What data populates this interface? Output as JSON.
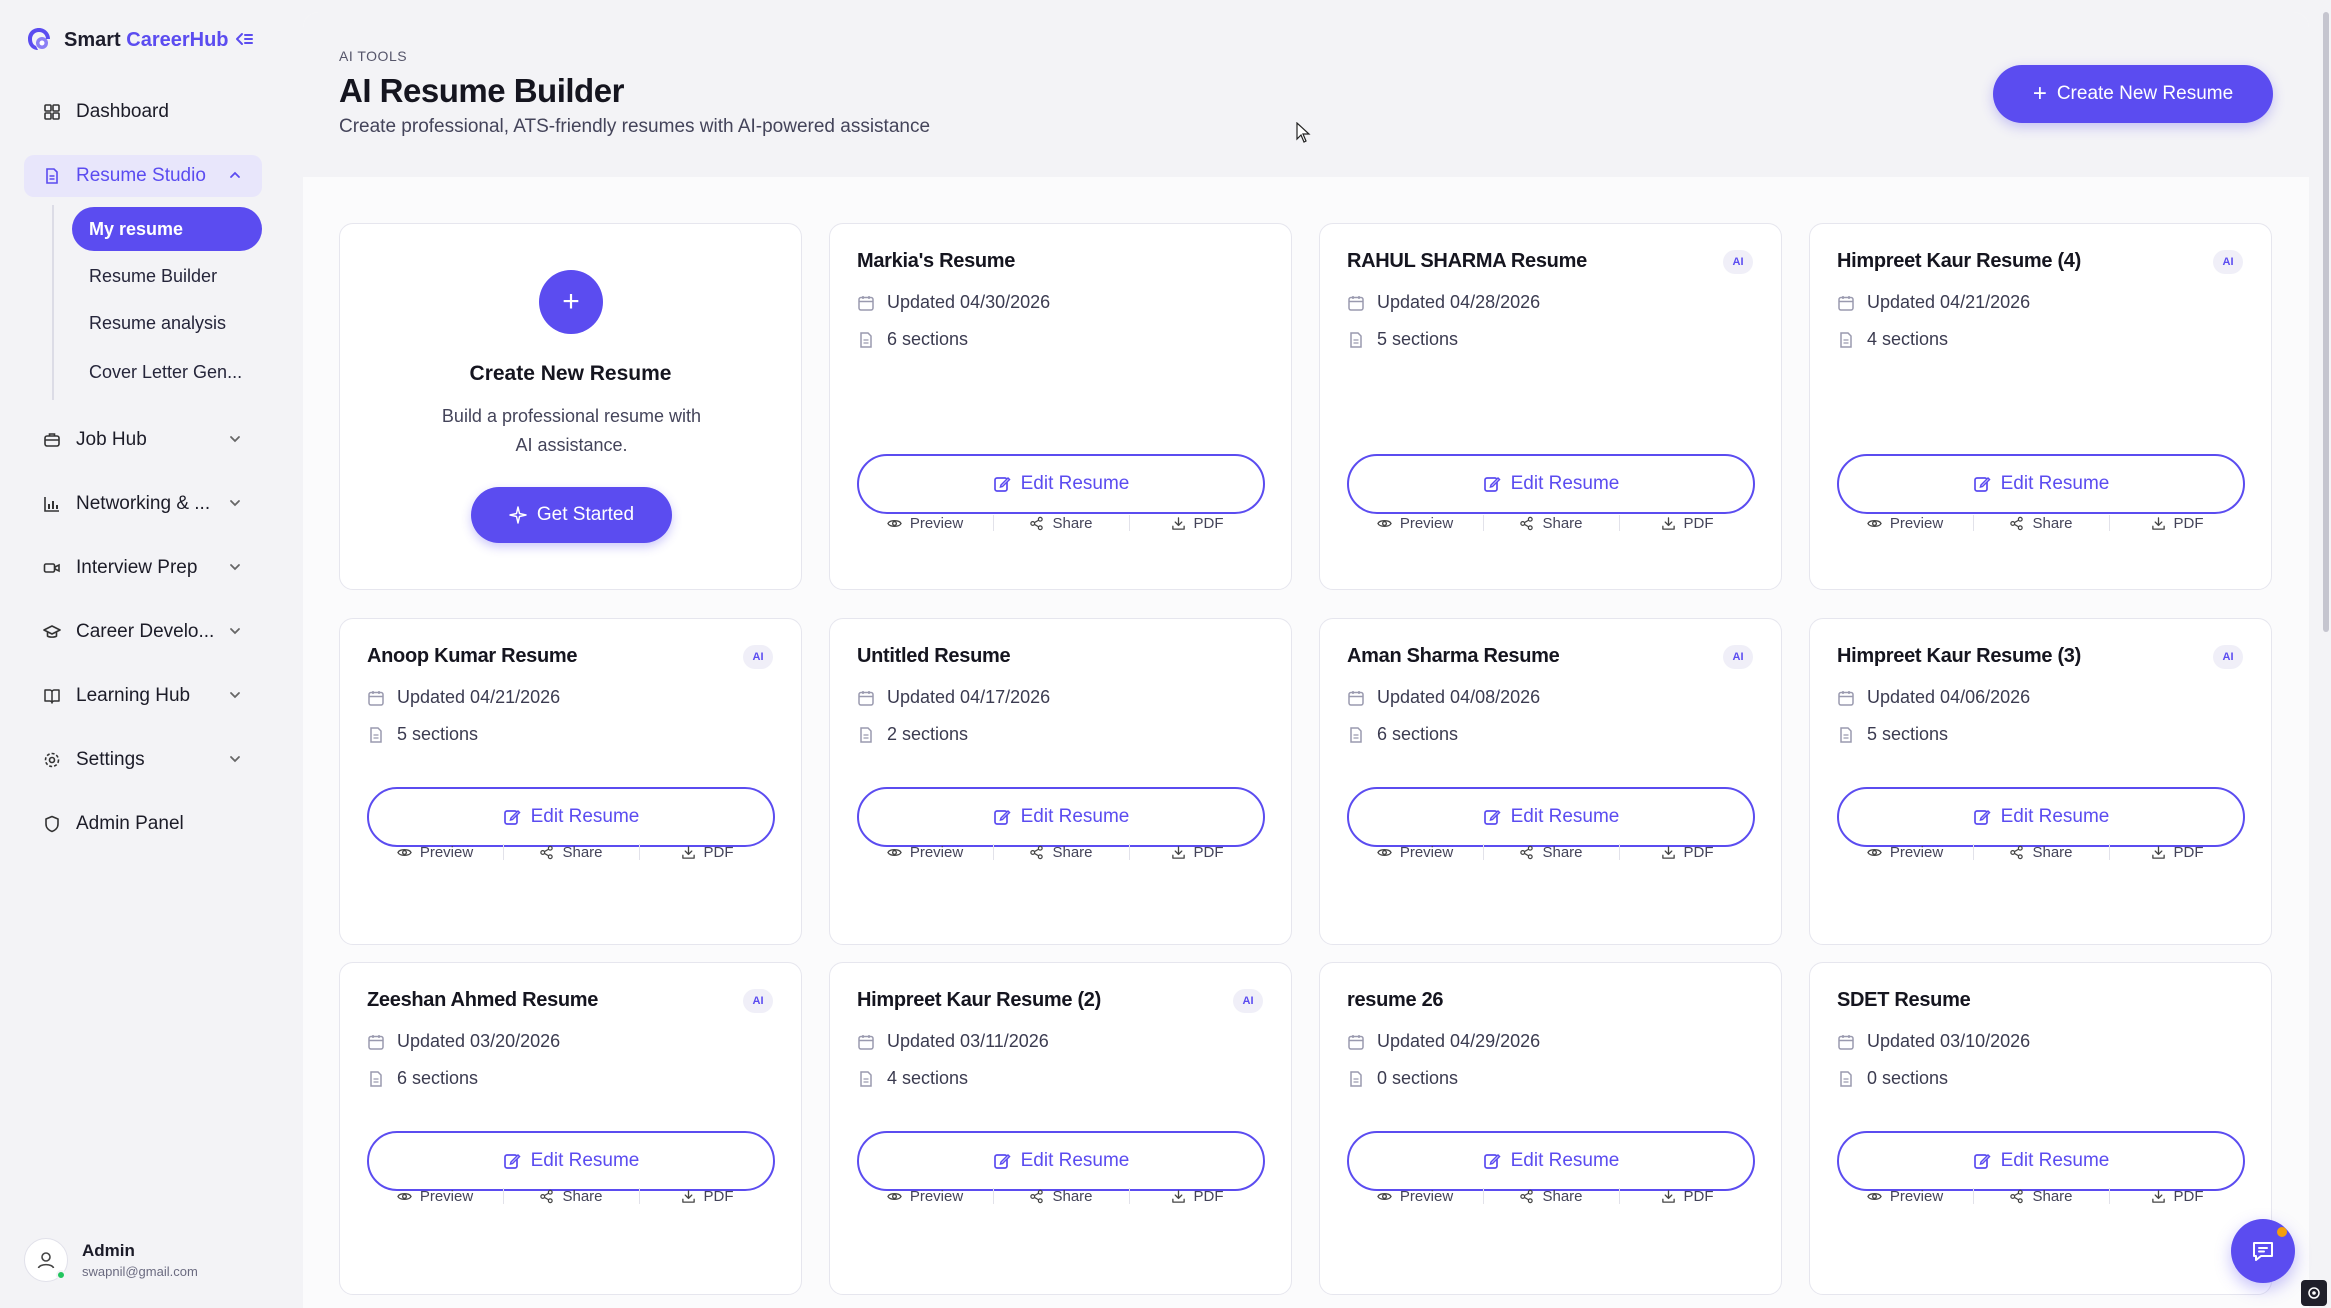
{
  "brand": {
    "name_part1": "Smart ",
    "name_part2": "CareerHub"
  },
  "nav": {
    "dashboard": "Dashboard",
    "resume_studio": "Resume Studio",
    "sub": [
      "My resume",
      "Resume Builder",
      "Resume analysis",
      "Cover Letter Gen..."
    ],
    "job_hub": "Job Hub",
    "networking": "Networking & ...",
    "interview": "Interview Prep",
    "career": "Career Develo...",
    "learning": "Learning Hub",
    "settings": "Settings",
    "admin": "Admin Panel"
  },
  "user": {
    "name": "Admin",
    "email": "swapnil@gmail.com"
  },
  "header": {
    "eyebrow": "AI TOOLS",
    "title": "AI Resume Builder",
    "subtitle": "Create professional, ATS-friendly resumes with AI-powered assistance",
    "create_button": "Create New Resume"
  },
  "create_card": {
    "title": "Create New Resume",
    "description": "Build a professional resume with AI assistance.",
    "button": "Get Started"
  },
  "labels": {
    "edit": "Edit Resume",
    "preview": "Preview",
    "share": "Share",
    "pdf": "PDF",
    "ai": "AI"
  },
  "resumes": [
    {
      "title": "Markia's Resume",
      "updated": "Updated 04/30/2026",
      "sections": "6 sections",
      "ai": false
    },
    {
      "title": "RAHUL SHARMA Resume",
      "updated": "Updated 04/28/2026",
      "sections": "5 sections",
      "ai": true
    },
    {
      "title": "Himpreet Kaur Resume (4)",
      "updated": "Updated 04/21/2026",
      "sections": "4 sections",
      "ai": true
    },
    {
      "title": "Anoop Kumar Resume",
      "updated": "Updated 04/21/2026",
      "sections": "5 sections",
      "ai": true
    },
    {
      "title": "Untitled Resume",
      "updated": "Updated 04/17/2026",
      "sections": "2 sections",
      "ai": false
    },
    {
      "title": "Aman Sharma Resume",
      "updated": "Updated 04/08/2026",
      "sections": "6 sections",
      "ai": true
    },
    {
      "title": "Himpreet Kaur Resume (3)",
      "updated": "Updated 04/06/2026",
      "sections": "5 sections",
      "ai": true
    },
    {
      "title": "Zeeshan Ahmed Resume",
      "updated": "Updated 03/20/2026",
      "sections": "6 sections",
      "ai": true
    },
    {
      "title": "Himpreet Kaur Resume (2)",
      "updated": "Updated 03/11/2026",
      "sections": "4 sections",
      "ai": true
    },
    {
      "title": "resume 26",
      "updated": "Updated 04/29/2026",
      "sections": "0 sections",
      "ai": false
    },
    {
      "title": "SDET Resume",
      "updated": "Updated 03/10/2026",
      "sections": "0 sections",
      "ai": false
    }
  ],
  "colors": {
    "accent": "#5b4cf0",
    "accent_soft": "#e8e6fb",
    "background": "#f3f3f6"
  }
}
